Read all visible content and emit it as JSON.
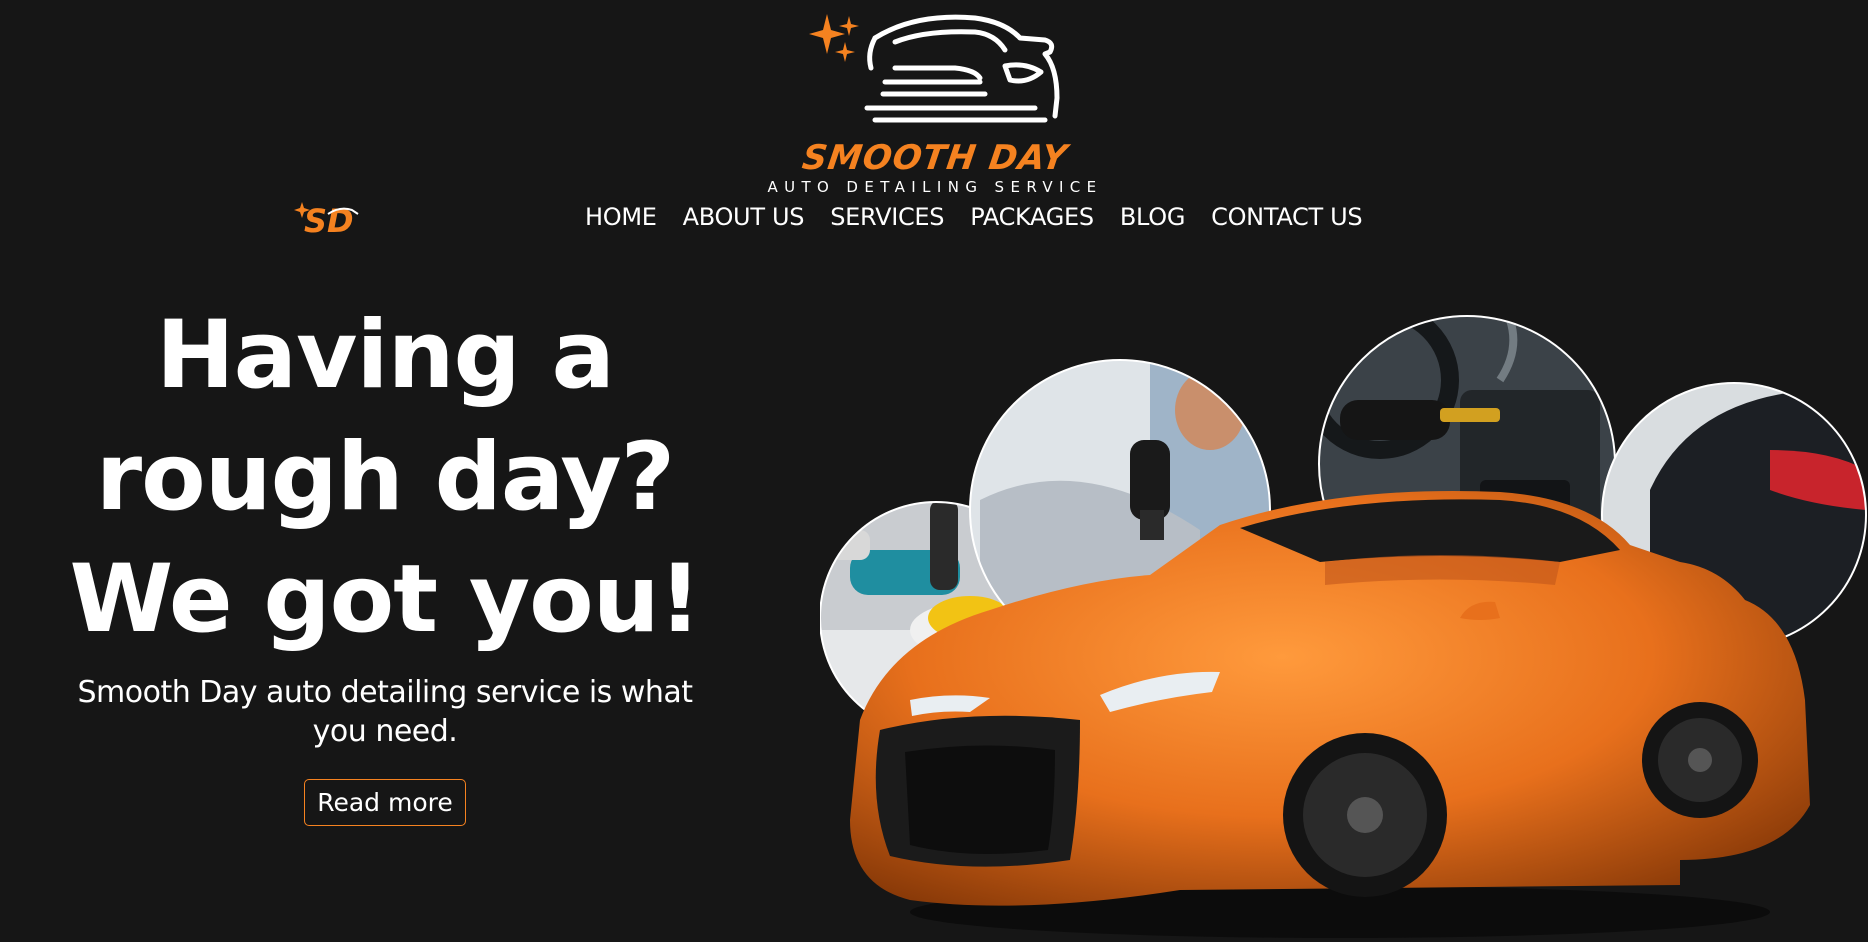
{
  "brand": {
    "name": "SMOOTH DAY",
    "tagline": "AUTO DETAILING SERVICE"
  },
  "nav": {
    "items": [
      {
        "label": "HOME"
      },
      {
        "label": "ABOUT US"
      },
      {
        "label": "SERVICES"
      },
      {
        "label": "PACKAGES"
      },
      {
        "label": "BLOG"
      },
      {
        "label": "CONTACT US"
      }
    ]
  },
  "hero": {
    "headline_line1": "Having a",
    "headline_line2": "rough day?",
    "headline_line3": "We got you!",
    "subhead_line1": "Smooth Day auto detailing service is what",
    "subhead_line2": "you need.",
    "cta_label": "Read more"
  },
  "colors": {
    "background": "#161616",
    "accent": "#f58220",
    "text": "#ffffff"
  },
  "icons": {
    "logo": "car-sparkle-logo-icon",
    "small_logo": "sd-monogram-icon"
  }
}
